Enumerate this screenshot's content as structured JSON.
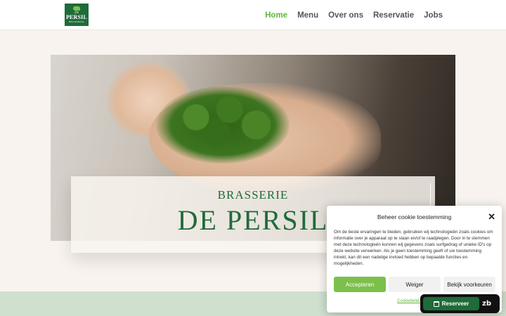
{
  "logo": {
    "top_text": "De",
    "name": "PERSIL",
    "sub": "BRASSERIE"
  },
  "nav": [
    {
      "label": "Home",
      "active": true
    },
    {
      "label": "Menu",
      "active": false
    },
    {
      "label": "Over ons",
      "active": false
    },
    {
      "label": "Reservatie",
      "active": false
    },
    {
      "label": "Jobs",
      "active": false
    }
  ],
  "hero": {
    "subtitle": "BRASSERIE",
    "title": "DE PERSIL"
  },
  "cookie": {
    "title": "Beheer cookie toestemming",
    "body": "Om de beste ervaringen te bieden, gebruiken wij technologieën zoals cookies om informatie over je apparaat op te slaan en/of te raadplegen. Door in te stemmen met deze technologieën kunnen wij gegevens zoals surfgedrag of unieke ID's op deze website verwerken. Als je geen toestemming geeft of uw toestemming intrekt, kan dit een nadelige invloed hebben op bepaalde functies en mogelijkheden.",
    "accept": "Accepteren",
    "deny": "Weiger",
    "prefs": "Bekijk voorkeuren",
    "policy": "Cookiebeleid"
  },
  "reserve": {
    "label": "Reserveer",
    "brand": "zb",
    "icon": "calendar-icon"
  },
  "colors": {
    "brand_green": "#1f6b3a",
    "accent_green": "#5fb83a",
    "button_green": "#7cc04b"
  }
}
